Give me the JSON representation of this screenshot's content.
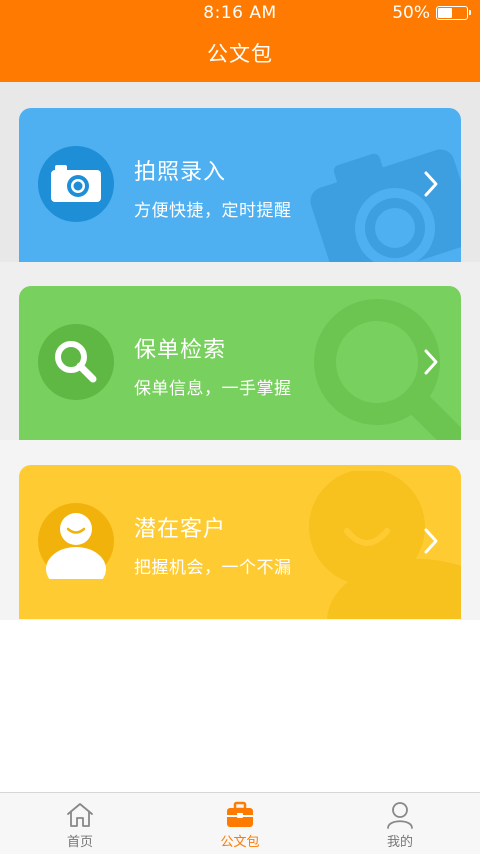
{
  "status_bar": {
    "time": "8:16 AM",
    "battery": "50%",
    "battery_level": 0.5
  },
  "header": {
    "title": "公文包"
  },
  "cards": [
    {
      "title": "拍照录入",
      "subtitle": "方便快捷，定时提醒",
      "icon": "camera-icon",
      "color": "#4fb0f1"
    },
    {
      "title": "保单检索",
      "subtitle": "保单信息，一手掌握",
      "icon": "search-icon",
      "color": "#78d05e"
    },
    {
      "title": "潜在客户",
      "subtitle": "把握机会，一个不漏",
      "icon": "person-icon",
      "color": "#ffcb33"
    }
  ],
  "tabbar": {
    "active": "公文包",
    "items": [
      {
        "label": "首页",
        "icon": "home-icon"
      },
      {
        "label": "公文包",
        "icon": "briefcase-icon"
      },
      {
        "label": "我的",
        "icon": "profile-icon"
      }
    ]
  },
  "colors": {
    "accent": "#ff7a00",
    "tab_inactive": "#777777"
  }
}
